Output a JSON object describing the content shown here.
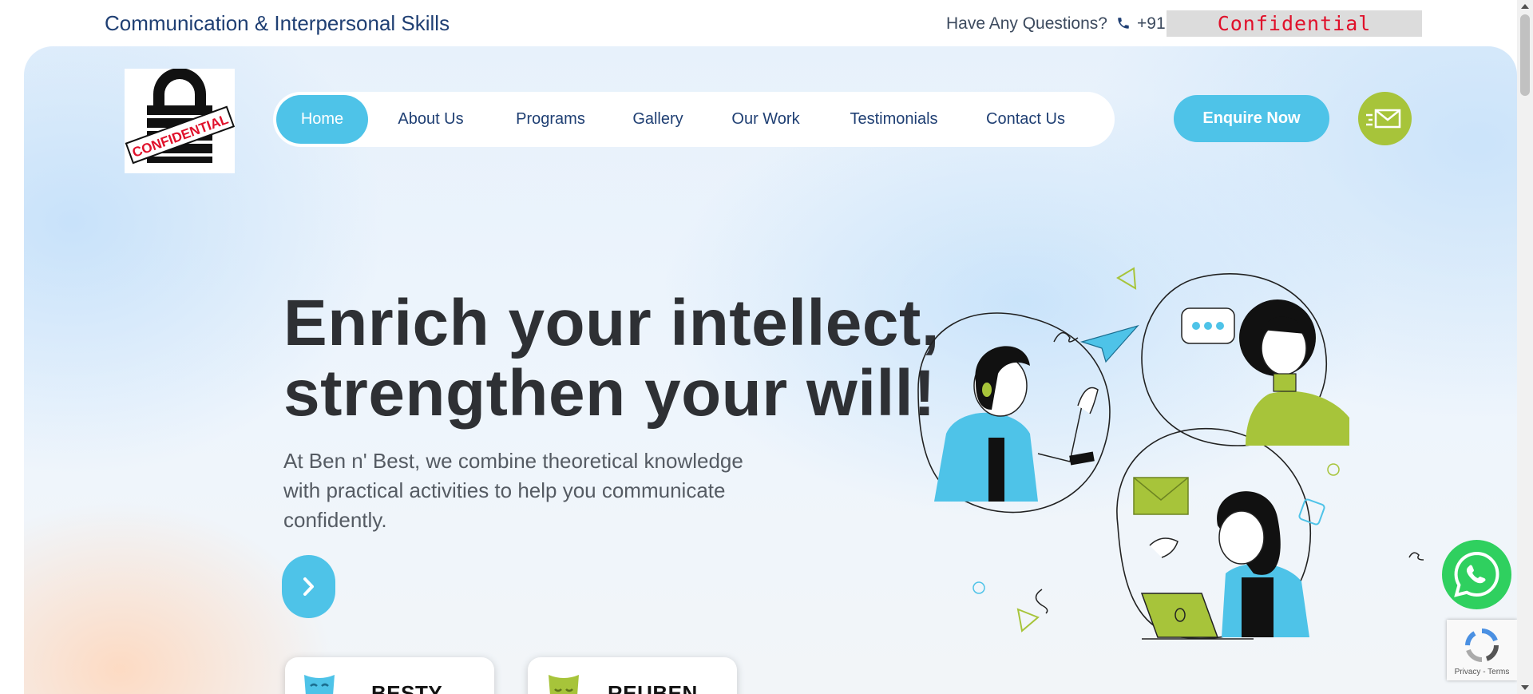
{
  "topbar": {
    "site_name": "Communication & Interpersonal Skills",
    "question": "Have Any Questions?",
    "phone_icon": "phone-icon",
    "phone_prefix": "+91",
    "redaction": "Confidential"
  },
  "logo": {
    "text": "CONFIDENTIAL",
    "icon": "padlock-icon"
  },
  "nav": {
    "items": [
      {
        "label": "Home",
        "active": true
      },
      {
        "label": "About Us",
        "active": false
      },
      {
        "label": "Programs",
        "active": false
      },
      {
        "label": "Gallery",
        "active": false
      },
      {
        "label": "Our Work",
        "active": false
      },
      {
        "label": "Testimonials",
        "active": false
      },
      {
        "label": "Contact Us",
        "active": false
      }
    ],
    "enquire_label": "Enquire Now",
    "mail_icon": "envelope-icon"
  },
  "hero": {
    "headline_line1": "Enrich your intellect,",
    "headline_line2": "strengthen your will!",
    "subtext": "At Ben n' Best, we combine theoretical knowledge with practical activities to help you communicate confidently.",
    "cta_icon": "chevron-right-icon"
  },
  "cards": [
    {
      "name": "BESTY",
      "icon": "blue-mask-icon"
    },
    {
      "name": "REUBEN",
      "icon": "green-mask-icon"
    }
  ],
  "widgets": {
    "whatsapp_icon": "whatsapp-icon",
    "recaptcha_text": "Privacy - Terms"
  },
  "colors": {
    "accent_blue": "#4ec3e8",
    "accent_green": "#a7c43a",
    "nav_text": "#1f3f73",
    "headline": "#2e3034"
  }
}
